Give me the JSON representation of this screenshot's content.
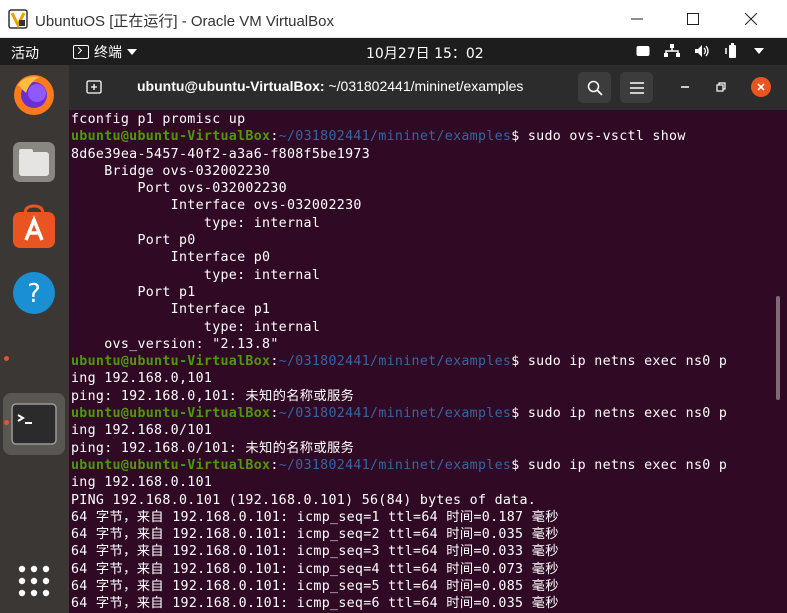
{
  "host": {
    "title": "UbuntuOS [正在运行] - Oracle VM VirtualBox",
    "icon": "virtualbox-icon"
  },
  "topbar": {
    "activities": "活动",
    "app_menu": "终端",
    "clock": "10月27日 15：02",
    "tray_icons": [
      "keyboard-icon",
      "network-icon",
      "volume-icon",
      "battery-icon",
      "chevron-down-icon"
    ]
  },
  "dock": {
    "apps": [
      "firefox-icon",
      "files-icon",
      "software-center-icon",
      "help-icon",
      "terminal-icon",
      "app-grid-icon"
    ],
    "accent": "#e95420"
  },
  "terminal": {
    "title_user": "ubuntu@ubuntu-VirtualBox:",
    "title_path": " ~/031802441/mininet/examples",
    "colors": {
      "bg": "#300a24",
      "prompt_user": "#4e9a06",
      "prompt_path": "#3465a4"
    },
    "prompt_user": "ubuntu@ubuntu-VirtualBox",
    "prompt_sep": ":",
    "prompt_path": "~/031802441/mininet/examples",
    "prompt_end": "$ ",
    "lines": [
      {
        "text": "fconfig p1 promisc up"
      },
      {
        "prompt": true,
        "cmd": "sudo ovs-vsctl show"
      },
      {
        "text": "8d6e39ea-5457-40f2-a3a6-f808f5be1973"
      },
      {
        "text": "    Bridge ovs-032002230"
      },
      {
        "text": "        Port ovs-032002230"
      },
      {
        "text": "            Interface ovs-032002230"
      },
      {
        "text": "                type: internal"
      },
      {
        "text": "        Port p0"
      },
      {
        "text": "            Interface p0"
      },
      {
        "text": "                type: internal"
      },
      {
        "text": "        Port p1"
      },
      {
        "text": "            Interface p1"
      },
      {
        "text": "                type: internal"
      },
      {
        "text": "    ovs_version: \"2.13.8\""
      },
      {
        "prompt": true,
        "cmd": "sudo ip netns exec ns0 p"
      },
      {
        "text": "ing 192.168.0,101"
      },
      {
        "text": "ping: 192.168.0,101: 未知的名称或服务"
      },
      {
        "prompt": true,
        "cmd": "sudo ip netns exec ns0 p"
      },
      {
        "text": "ing 192.168.0/101"
      },
      {
        "text": "ping: 192.168.0/101: 未知的名称或服务"
      },
      {
        "prompt": true,
        "cmd": "sudo ip netns exec ns0 p"
      },
      {
        "text": "ing 192.168.0.101"
      },
      {
        "text": "PING 192.168.0.101 (192.168.0.101) 56(84) bytes of data."
      },
      {
        "text": "64 字节，来自 192.168.0.101: icmp_seq=1 ttl=64 时间=0.187 毫秒"
      },
      {
        "text": "64 字节，来自 192.168.0.101: icmp_seq=2 ttl=64 时间=0.035 毫秒"
      },
      {
        "text": "64 字节，来自 192.168.0.101: icmp_seq=3 ttl=64 时间=0.033 毫秒"
      },
      {
        "text": "64 字节，来自 192.168.0.101: icmp_seq=4 ttl=64 时间=0.073 毫秒"
      },
      {
        "text": "64 字节，来自 192.168.0.101: icmp_seq=5 ttl=64 时间=0.085 毫秒"
      },
      {
        "text": "64 字节，来自 192.168.0.101: icmp_seq=6 ttl=64 时间=0.035 毫秒"
      }
    ]
  }
}
